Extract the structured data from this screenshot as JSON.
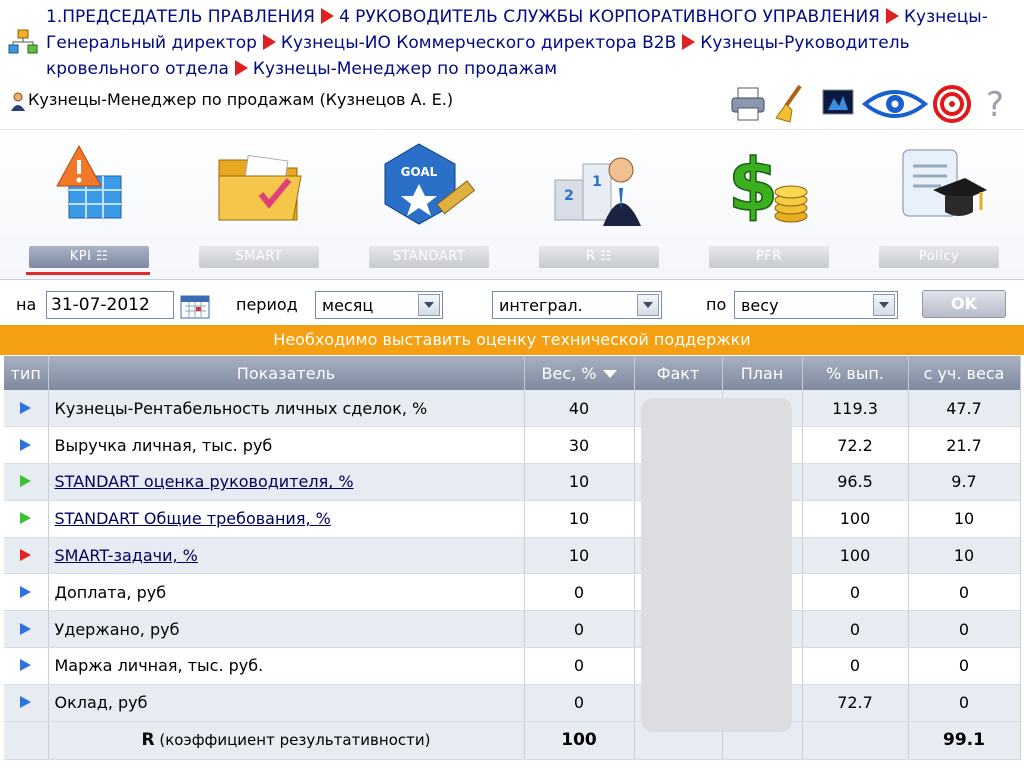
{
  "breadcrumb": {
    "items": [
      "1.ПРЕДСЕДАТЕЛЬ ПРАВЛЕНИЯ",
      "4 РУКОВОДИТЕЛЬ СЛУЖБЫ КОРПОРАТИВНОГО УПРАВЛЕНИЯ",
      "Кузнецы-Генеральный директор",
      "Кузнецы-ИО Коммерческого директора B2B",
      "Кузнецы-Руководитель кровельного отдела",
      "Кузнецы-Менеджер по продажам"
    ]
  },
  "user": {
    "title": "Кузнецы-Менеджер по продажам  (Кузнецов А. Е.)"
  },
  "toolbar": [
    "printer-icon",
    "broom-icon",
    "monitor-icon",
    "eye-icon",
    "target-icon",
    "help-icon"
  ],
  "modules": [
    {
      "label": "KPI ☷",
      "icon": "kpi-icon",
      "active": true
    },
    {
      "label": "SMART",
      "icon": "smart-folder-icon",
      "active": false
    },
    {
      "label": "STANDART",
      "icon": "goal-icon",
      "active": false
    },
    {
      "label": "R ☷",
      "icon": "podium-icon",
      "active": false
    },
    {
      "label": "PFR",
      "icon": "dollar-coins-icon",
      "active": false
    },
    {
      "label": "Policy",
      "icon": "diploma-icon",
      "active": false
    }
  ],
  "filters": {
    "date_label": "на",
    "date_value": "31-07-2012",
    "period_label": "период",
    "period_value": "месяц",
    "mode_value": "интеграл.",
    "by_label": "по",
    "by_value": "весу",
    "ok_label": "OK"
  },
  "notice": "Необходимо выставить оценку технической поддержки",
  "table": {
    "headers": [
      "тип",
      "Показатель",
      "Вес, %",
      "Факт",
      "План",
      "% вып.",
      "с уч. веса"
    ],
    "rows": [
      {
        "type": "blue",
        "name": "Кузнецы-Рентабельность личных сделок, %",
        "link": false,
        "weight": "40",
        "pct": "119.3",
        "weighted": "47.7"
      },
      {
        "type": "blue",
        "name": "Выручка личная, тыс. руб",
        "link": false,
        "weight": "30",
        "pct": "72.2",
        "weighted": "21.7"
      },
      {
        "type": "green",
        "name": "STANDART оценка руководителя, %",
        "link": true,
        "weight": "10",
        "pct": "96.5",
        "weighted": "9.7"
      },
      {
        "type": "green",
        "name": "STANDART Общие требования, %",
        "link": true,
        "weight": "10",
        "pct": "100",
        "weighted": "10"
      },
      {
        "type": "red",
        "name": "SMART-задачи, %",
        "link": true,
        "weight": "10",
        "pct": "100",
        "weighted": "10"
      },
      {
        "type": "blue",
        "name": "Доплата, руб",
        "link": false,
        "weight": "0",
        "pct": "0",
        "weighted": "0"
      },
      {
        "type": "blue",
        "name": "Удержано, руб",
        "link": false,
        "weight": "0",
        "pct": "0",
        "weighted": "0"
      },
      {
        "type": "blue",
        "name": "Маржа личная, тыс. руб.",
        "link": false,
        "weight": "0",
        "pct": "0",
        "weighted": "0"
      },
      {
        "type": "blue",
        "name": "Оклад, руб",
        "link": false,
        "weight": "0",
        "pct": "72.7",
        "weighted": "0"
      }
    ],
    "total": {
      "label_bold": "R",
      "label_rest": " (коэффициент результативности)",
      "weight": "100",
      "weighted": "99.1"
    }
  },
  "colors": {
    "notice": "#f59f12",
    "link": "#000b80",
    "header": "#8a94a8",
    "active_underline": "#e32a2a"
  }
}
